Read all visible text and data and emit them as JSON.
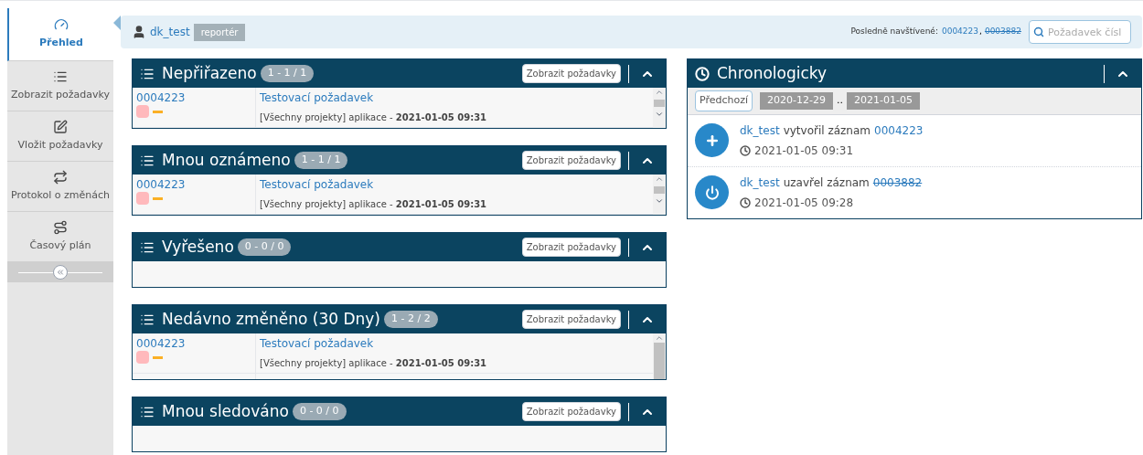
{
  "sidebar": {
    "items": [
      {
        "kind": "dashboard",
        "label": "Přehled",
        "selected": true
      },
      {
        "kind": "list",
        "label": "Zobrazit požadavky",
        "selected": false
      },
      {
        "kind": "edit",
        "label": "Vložit požadavky",
        "selected": false
      },
      {
        "kind": "changes",
        "label": "Protokol o změnách",
        "selected": false
      },
      {
        "kind": "road",
        "label": "Časový plán",
        "selected": false
      }
    ]
  },
  "header": {
    "user": "dk_test",
    "role": "reportér",
    "recent_label": "Posledně navštívené:",
    "recent": [
      {
        "id": "0004223",
        "closed": false
      },
      {
        "id": "0003882",
        "closed": true
      }
    ],
    "recent_separator": ",",
    "search": {
      "placeholder": "Požadavek čísl"
    }
  },
  "panels": [
    {
      "title": "Nepřiřazeno",
      "count": "1 - 1 / 1",
      "button": "Zobrazit požadavky",
      "rows": [
        {
          "id": "0004223",
          "summary": "Testovací požadavek",
          "meta": "[Všechny projekty] aplikace - ",
          "date": "2021-01-05 09:31"
        }
      ],
      "more_rows": false
    },
    {
      "title": "Mnou oznámeno",
      "count": "1 - 1 / 1",
      "button": "Zobrazit požadavky",
      "rows": [
        {
          "id": "0004223",
          "summary": "Testovací požadavek",
          "meta": "[Všechny projekty] aplikace - ",
          "date": "2021-01-05 09:31"
        }
      ],
      "more_rows": false
    },
    {
      "title": "Vyřešeno",
      "count": "0 - 0 / 0",
      "button": "Zobrazit požadavky"
    },
    {
      "title": "Nedávno změněno (30 Dny)",
      "count": "1 - 2 / 2",
      "button": "Zobrazit požadavky",
      "rows": [
        {
          "id": "0004223",
          "summary": "Testovací požadavek",
          "meta": "[Všechny projekty] aplikace - ",
          "date": "2021-01-05 09:31"
        }
      ],
      "more_rows": true
    },
    {
      "title": "Mnou sledováno",
      "count": "0 - 0 / 0",
      "button": "Zobrazit požadavky"
    }
  ],
  "timeline": {
    "title": "Chronologicky",
    "prev_button": "Předchozí",
    "from": "2020-12-29",
    "separator": "..",
    "to": "2021-01-05",
    "events": [
      {
        "kind": "created",
        "user": "dk_test",
        "action": "vytvořil záznam",
        "issue": "0004223",
        "closed": false,
        "time": "2021-01-05 09:31"
      },
      {
        "kind": "closed",
        "user": "dk_test",
        "action": "uzavřel záznam",
        "issue": "0003882",
        "closed": true,
        "time": "2021-01-05 09:28"
      }
    ]
  }
}
